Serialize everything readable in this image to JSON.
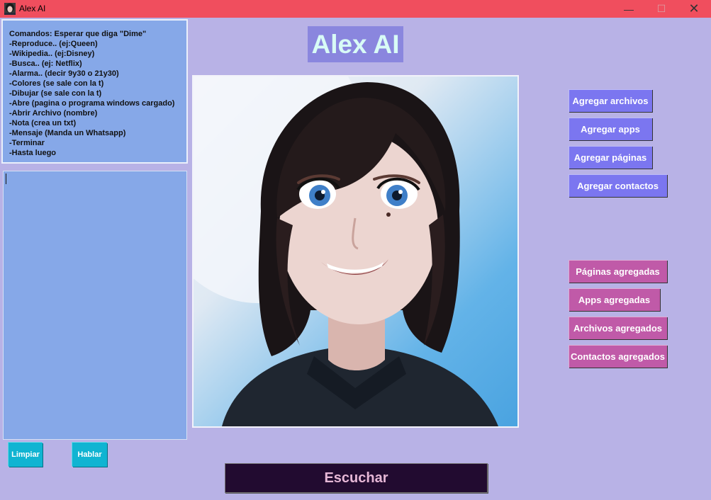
{
  "window": {
    "title": "Alex AI",
    "controls": {
      "minimize": "—",
      "maximize": "☐",
      "close": "✕"
    }
  },
  "commands": {
    "lines": [
      "Comandos: Esperar que diga \"Dime\"",
      "-Reproduce.. (ej:Queen)",
      "-Wikipedia.. (ej:Disney)",
      "-Busca.. (ej: Netflix)",
      "-Alarma.. (decir 9y30 o 21y30)",
      "-Colores (se sale con la t)",
      "-Dibujar (se sale con la t)",
      "-Abre (pagina o programa windows cargado)",
      "-Abrir Archivo (nombre)",
      "-Nota (crea un txt)",
      "-Mensaje (Manda un Whatsapp)",
      "-Terminar",
      "-Hasta luego"
    ]
  },
  "chat_box": {
    "value": ""
  },
  "left_buttons": {
    "clear": "Limpiar",
    "speak": "Hablar"
  },
  "header": {
    "title": "Alex AI"
  },
  "add_buttons": {
    "files": "Agregar archivos",
    "apps": "Agregar apps",
    "pages": "Agregar páginas",
    "contacts": "Agregar contactos"
  },
  "added_buttons": {
    "pages": "Páginas agregadas",
    "apps": "Apps agregadas",
    "files": "Archivos agregados",
    "contacts": "Contactos agregados"
  },
  "listen_button": "Escuchar",
  "colors": {
    "background": "#b8b2e6",
    "titlebar": "#f04e5e",
    "panel": "#86a8e8",
    "add_button": "#7b76f0",
    "added_button": "#c05aa8",
    "small_button": "#10b4d2",
    "listen_button_bg": "#220b30"
  }
}
